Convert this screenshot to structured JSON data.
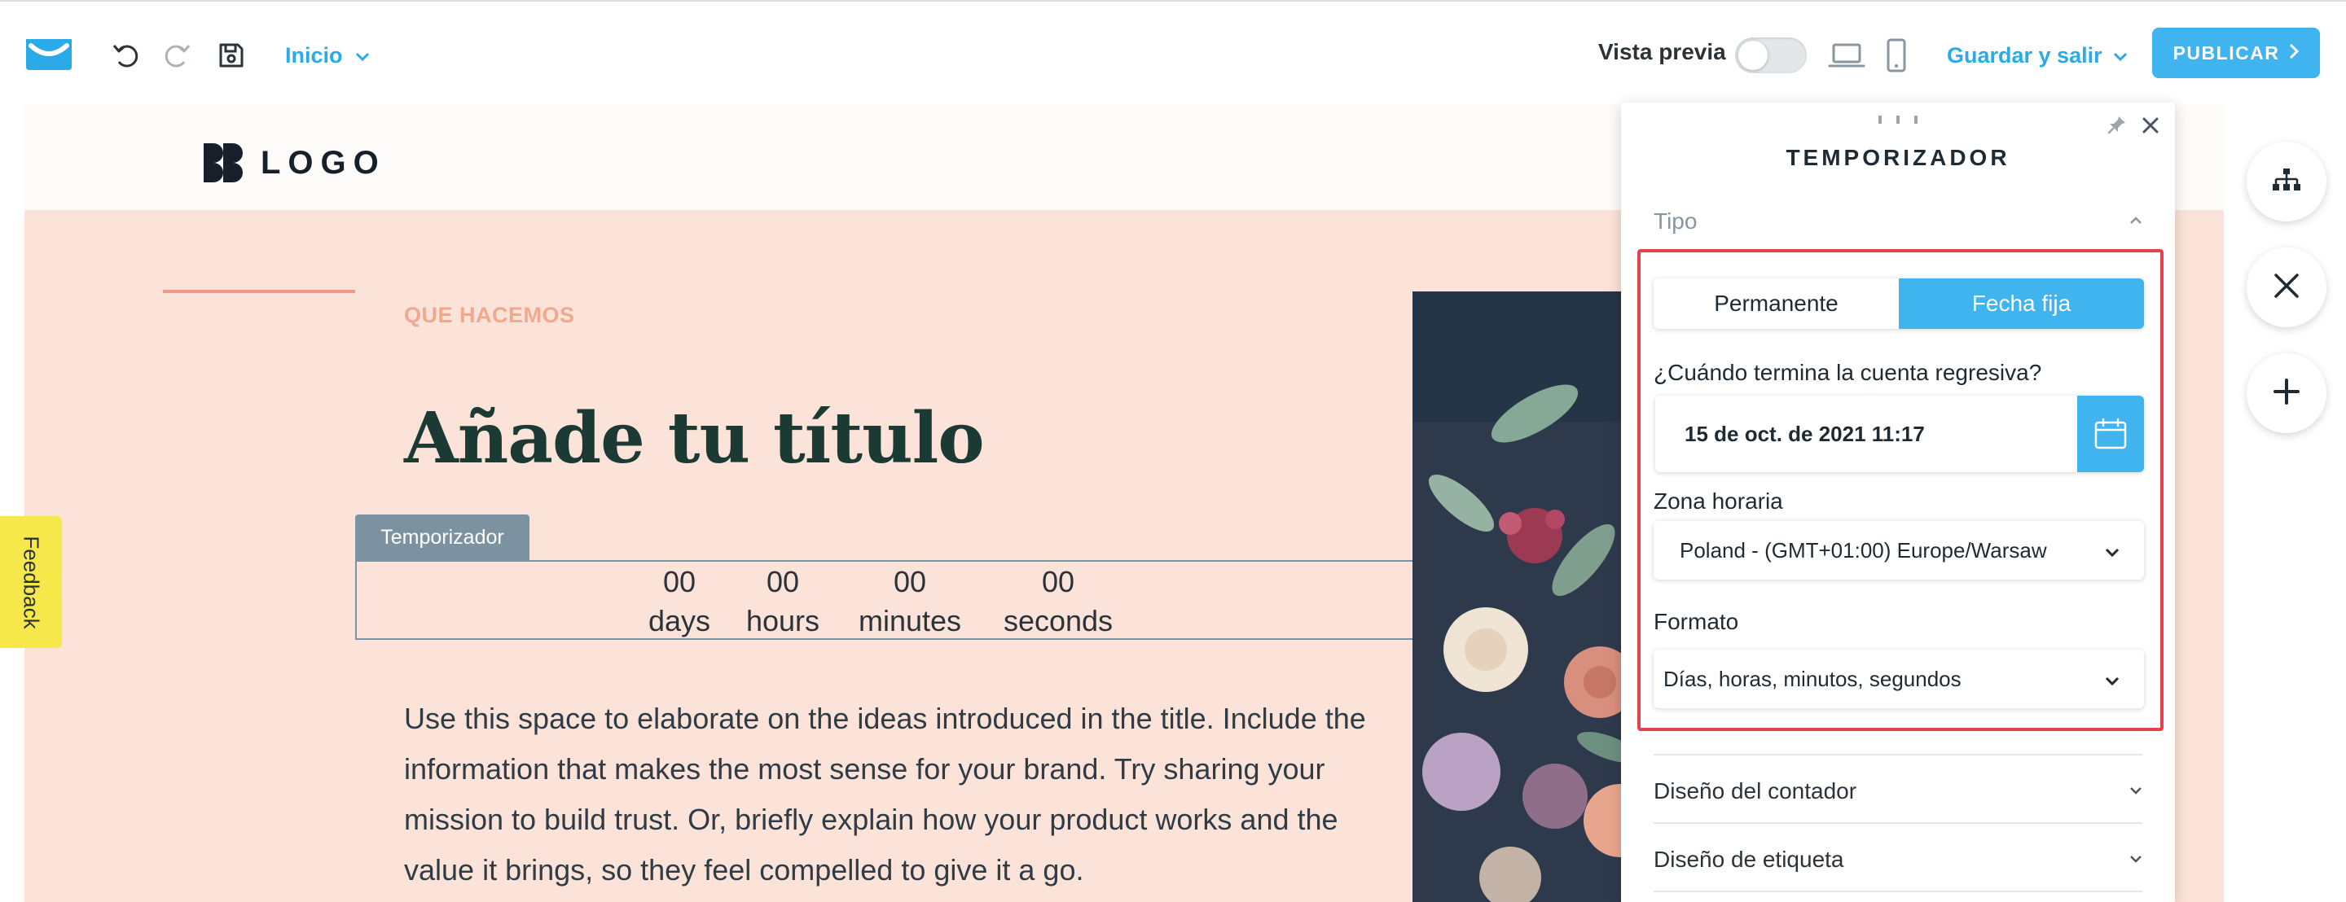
{
  "toolbar": {
    "page_selector_label": "Inicio",
    "preview_label": "Vista previa",
    "preview_enabled": false,
    "save_exit_label": "Guardar y salir",
    "publish_label": "PUBLICAR"
  },
  "canvas": {
    "logo_text": "LOGO",
    "eyebrow": "QUE HACEMOS",
    "headline": "Añade tu título",
    "timer_tag": "Temporizador",
    "timer_units": [
      {
        "value": "00",
        "label": "days"
      },
      {
        "value": "00",
        "label": "hours"
      },
      {
        "value": "00",
        "label": "minutes"
      },
      {
        "value": "00",
        "label": "seconds"
      }
    ],
    "body_text": "Use this space to elaborate on the ideas introduced in the title. Include the information that makes the most sense for your brand. Try sharing your mission to build trust. Or, briefly explain how your product works and the value it brings, so they feel compelled to give it a go."
  },
  "feedback_label": "Feedback",
  "panel": {
    "title": "TEMPORIZADOR",
    "type_section": "Tipo",
    "type_options": [
      "Permanente",
      "Fecha fija"
    ],
    "type_selected": "Fecha fija",
    "end_question": "¿Cuándo termina la cuenta regresiva?",
    "end_date": "15 de oct. de 2021 11:17",
    "timezone_label": "Zona horaria",
    "timezone_value": "Poland - (GMT+01:00) Europe/Warsaw",
    "format_label": "Formato",
    "format_value": "Días, horas, minutos, segundos",
    "counter_design": "Diseño del contador",
    "label_design": "Diseño de etiqueta"
  },
  "colors": {
    "accent": "#3fb4ee",
    "canvas_bg": "#fce3da",
    "headline": "#1b3a33",
    "highlight": "#e2424a",
    "feedback": "#f6e84a"
  },
  "icons": [
    "brand-logo-icon",
    "undo-icon",
    "redo-icon",
    "save-icon",
    "chevron-down-icon",
    "laptop-icon",
    "mobile-icon",
    "chevron-right-icon",
    "pin-icon",
    "close-icon",
    "chevron-up-icon",
    "calendar-icon",
    "sitemap-icon",
    "cross-icon",
    "plus-icon"
  ]
}
